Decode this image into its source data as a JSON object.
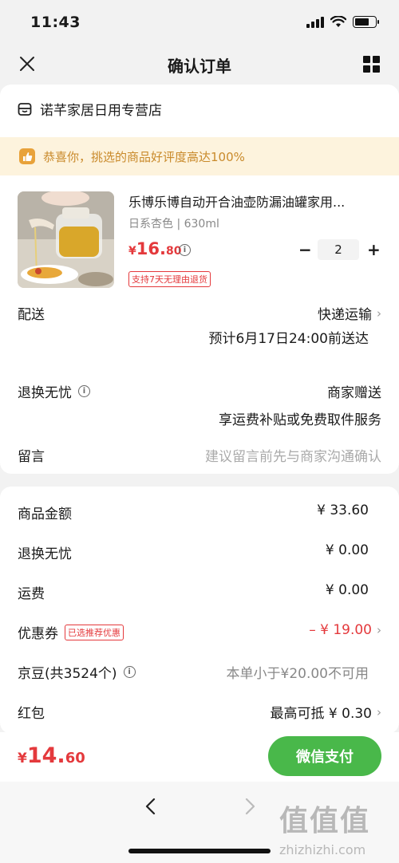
{
  "status_bar": {
    "time": "11:43"
  },
  "nav": {
    "title": "确认订单"
  },
  "store": {
    "name": "诺芊家居日用专营店"
  },
  "praise": {
    "text": "恭喜你，挑选的商品好评度高达100%"
  },
  "product": {
    "title": "乐博乐博自动开合油壶防漏油罐家用...",
    "spec": "日系杏色 | 630ml",
    "price_symbol": "¥",
    "price_int": "16.",
    "price_dec": "80",
    "quantity": "2",
    "return_badge": "支持7天无理由退货"
  },
  "delivery": {
    "label": "配送",
    "method": "快递运输",
    "eta": "预计6月17日24:00前送达"
  },
  "worry_free": {
    "label": "退换无忧",
    "value": "商家赠送",
    "desc": "享运费补贴或免费取件服务"
  },
  "message": {
    "label": "留言",
    "placeholder": "建议留言前先与商家沟通确认"
  },
  "summary": {
    "goods_amount_label": "商品金额",
    "goods_amount": "¥ 33.60",
    "worry_free_label": "退换无忧",
    "worry_free_amount": "¥ 0.00",
    "shipping_label": "运费",
    "shipping_amount": "¥ 0.00",
    "coupon_label": "优惠券",
    "coupon_badge": "已选推荐优惠",
    "coupon_amount": "– ¥ 19.00",
    "jd_bean_label": "京豆(共3524个)",
    "jd_bean_value": "本单小于¥20.00不可用",
    "red_packet_label": "红包",
    "red_packet_value": "最高可抵 ¥ 0.30"
  },
  "pay": {
    "total_symbol": "¥",
    "total_int": "14.",
    "total_dec": "60",
    "button_label": "微信支付"
  },
  "watermark": {
    "logo": "值值值",
    "site": "zhizhizhi.com"
  },
  "colors": {
    "accent_red": "#e4393c",
    "pay_green": "#49b84a",
    "praise_bg": "#fdf3dd"
  }
}
